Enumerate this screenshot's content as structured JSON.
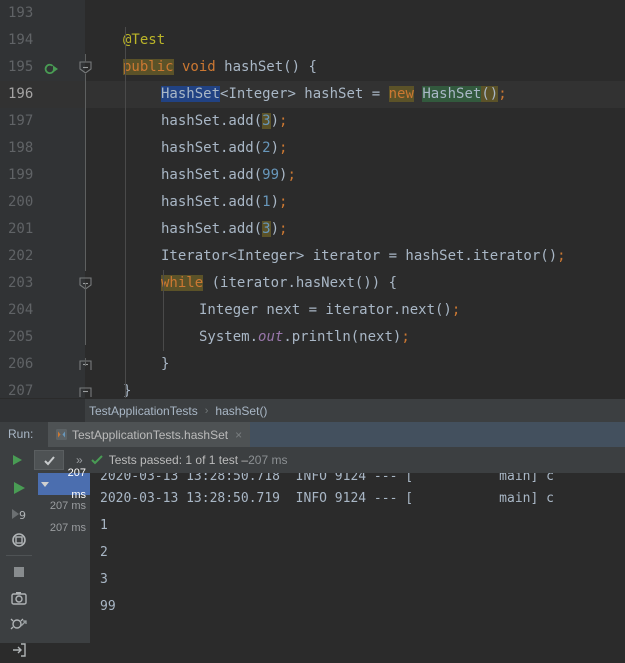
{
  "editor": {
    "lines": [
      {
        "num": "193",
        "segments": [],
        "fold": null,
        "run_icon": false,
        "caret": false
      },
      {
        "num": "194",
        "segments": [
          {
            "t": "@Test",
            "c": "anno"
          }
        ],
        "indent": 1,
        "fold": null,
        "run_icon": false,
        "caret": false
      },
      {
        "num": "195",
        "segments": [
          {
            "t": "public",
            "c": "kw-hl"
          },
          {
            "t": " void ",
            "c": "kw"
          },
          {
            "t": "hashSet",
            "c": "cls"
          },
          {
            "t": "() {",
            "c": "punct"
          }
        ],
        "indent": 1,
        "fold": "collapse",
        "run_icon": true,
        "caret": false
      },
      {
        "num": "196",
        "segments": [
          {
            "t": "HashSet",
            "c": "sel"
          },
          {
            "t": "<Integer> hashSet = ",
            "c": "punct"
          },
          {
            "t": "new",
            "c": "kw-hl"
          },
          {
            "t": " ",
            "c": "punct"
          },
          {
            "t": "HashSet",
            "c": "grn-bg"
          },
          {
            "t": "()",
            "c": "olv-bg"
          },
          {
            "t": ";",
            "c": "semi"
          }
        ],
        "indent": 2,
        "fold": null,
        "run_icon": false,
        "caret": true
      },
      {
        "num": "197",
        "segments": [
          {
            "t": "hashSet.add(",
            "c": "punct"
          },
          {
            "t": "3",
            "c": "num-hl"
          },
          {
            "t": ")",
            "c": "punct"
          },
          {
            "t": ";",
            "c": "semi"
          }
        ],
        "indent": 2,
        "fold": null,
        "run_icon": false,
        "caret": false
      },
      {
        "num": "198",
        "segments": [
          {
            "t": "hashSet.add(",
            "c": "punct"
          },
          {
            "t": "2",
            "c": "num"
          },
          {
            "t": ")",
            "c": "punct"
          },
          {
            "t": ";",
            "c": "semi"
          }
        ],
        "indent": 2,
        "fold": null,
        "run_icon": false,
        "caret": false
      },
      {
        "num": "199",
        "segments": [
          {
            "t": "hashSet.add(",
            "c": "punct"
          },
          {
            "t": "99",
            "c": "num"
          },
          {
            "t": ")",
            "c": "punct"
          },
          {
            "t": ";",
            "c": "semi"
          }
        ],
        "indent": 2,
        "fold": null,
        "run_icon": false,
        "caret": false
      },
      {
        "num": "200",
        "segments": [
          {
            "t": "hashSet.add(",
            "c": "punct"
          },
          {
            "t": "1",
            "c": "num"
          },
          {
            "t": ")",
            "c": "punct"
          },
          {
            "t": ";",
            "c": "semi"
          }
        ],
        "indent": 2,
        "fold": null,
        "run_icon": false,
        "caret": false
      },
      {
        "num": "201",
        "segments": [
          {
            "t": "hashSet.add(",
            "c": "punct"
          },
          {
            "t": "3",
            "c": "num-hl"
          },
          {
            "t": ")",
            "c": "punct"
          },
          {
            "t": ";",
            "c": "semi"
          }
        ],
        "indent": 2,
        "fold": null,
        "run_icon": false,
        "caret": false
      },
      {
        "num": "202",
        "segments": [
          {
            "t": "Iterator<Integer> iterator = hashSet.iterator()",
            "c": "punct"
          },
          {
            "t": ";",
            "c": "semi"
          }
        ],
        "indent": 2,
        "fold": null,
        "run_icon": false,
        "caret": false
      },
      {
        "num": "203",
        "segments": [
          {
            "t": "while",
            "c": "kw-hl"
          },
          {
            "t": " (iterator.hasNext()) {",
            "c": "punct"
          }
        ],
        "indent": 2,
        "fold": "collapse",
        "run_icon": false,
        "caret": false
      },
      {
        "num": "204",
        "segments": [
          {
            "t": "Integer next = iterator.next()",
            "c": "punct"
          },
          {
            "t": ";",
            "c": "semi"
          }
        ],
        "indent": 3,
        "fold": null,
        "run_icon": false,
        "caret": false
      },
      {
        "num": "205",
        "segments": [
          {
            "t": "System.",
            "c": "punct"
          },
          {
            "t": "out",
            "c": "field-it"
          },
          {
            "t": ".println(next)",
            "c": "punct"
          },
          {
            "t": ";",
            "c": "semi"
          }
        ],
        "indent": 3,
        "fold": null,
        "run_icon": false,
        "caret": false
      },
      {
        "num": "206",
        "segments": [
          {
            "t": "}",
            "c": "punct"
          }
        ],
        "indent": 2,
        "fold": "end",
        "run_icon": false,
        "caret": false
      },
      {
        "num": "207",
        "segments": [
          {
            "t": "}",
            "c": "punct"
          }
        ],
        "indent": 1,
        "fold": "end",
        "run_icon": false,
        "caret": false
      }
    ]
  },
  "breadcrumb": {
    "class_name": "TestApplicationTests",
    "separator": "›",
    "method_name": "hashSet()"
  },
  "run_window": {
    "label": "Run:",
    "tab_title": "TestApplicationTests.hashSet",
    "tab_close": "×",
    "status": {
      "chevrons": "»",
      "text": "Tests passed: 1 of 1 test – ",
      "duration": "207 ms"
    },
    "side_toolbar": [
      {
        "name": "rerun-tests-icon"
      },
      {
        "name": "rerun-failed-tests-icon"
      },
      {
        "name": "toggle-auto-test-icon"
      },
      {
        "name": "stop-icon"
      },
      {
        "name": "export-test-results-icon"
      },
      {
        "name": "debug-icon"
      },
      {
        "name": "import-test-results-icon"
      }
    ],
    "tree_rows": [
      {
        "duration": "207 ms",
        "selected": true
      },
      {
        "duration": "207 ms",
        "selected": false
      },
      {
        "duration": "207 ms",
        "selected": false
      }
    ],
    "console_lines": [
      "2020-03-13 13:28:50.718  INFO 9124 --- [           main] c",
      "2020-03-13 13:28:50.719  INFO 9124 --- [           main] c",
      "1",
      "2",
      "3",
      "99"
    ]
  },
  "colors": {
    "editor_bg": "#2b2b2b",
    "gutter_bg": "#313335",
    "panel_bg": "#3c3f41",
    "selection_blue": "#214283",
    "tree_selected": "#4b6eaf",
    "keyword_orange": "#cc7832",
    "annotation_yellow": "#bbb529",
    "number_blue": "#6897bb",
    "text_grey": "#a9b7c6",
    "success_green": "#499c54"
  }
}
